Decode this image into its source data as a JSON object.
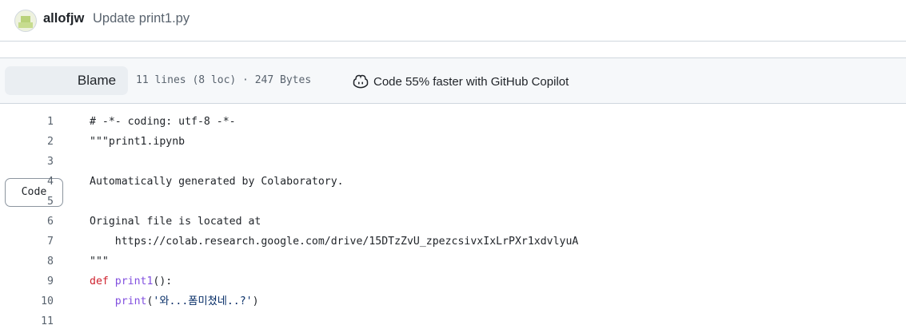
{
  "commit": {
    "author": "allofjw",
    "message": "Update print1.py"
  },
  "toolbar": {
    "code_label": "Code",
    "blame_label": "Blame",
    "file_meta": "11 lines (8 loc) · 247 Bytes",
    "copilot_label": "Code 55% faster with GitHub Copilot"
  },
  "code": {
    "lines": [
      {
        "num": "1",
        "text": "# -*- coding: utf-8 -*-"
      },
      {
        "num": "2",
        "text": "\"\"\"print1.ipynb"
      },
      {
        "num": "3",
        "text": ""
      },
      {
        "num": "4",
        "text": "Automatically generated by Colaboratory."
      },
      {
        "num": "5",
        "text": ""
      },
      {
        "num": "6",
        "text": "Original file is located at"
      },
      {
        "num": "7",
        "text": "    https://colab.research.google.com/drive/15DTzZvU_zpezcsivxIxLrPXr1xdvlyuA"
      },
      {
        "num": "8",
        "text": "\"\"\""
      },
      {
        "num": "9",
        "kw": "def ",
        "fn": "print1",
        "rest": "():"
      },
      {
        "num": "10",
        "indent": "    ",
        "fn": "print",
        "open": "(",
        "str": "'와...폼미쳤네..?'",
        "close": ")"
      },
      {
        "num": "11",
        "text": ""
      }
    ]
  },
  "colors": {
    "keyword": "#cf222e",
    "function": "#8250df",
    "string": "#0a3069",
    "border": "#d0d7de",
    "toolbar_bg": "#f6f8fa"
  },
  "icons": {
    "avatar": "identicon-avatar",
    "copilot": "copilot-icon"
  }
}
